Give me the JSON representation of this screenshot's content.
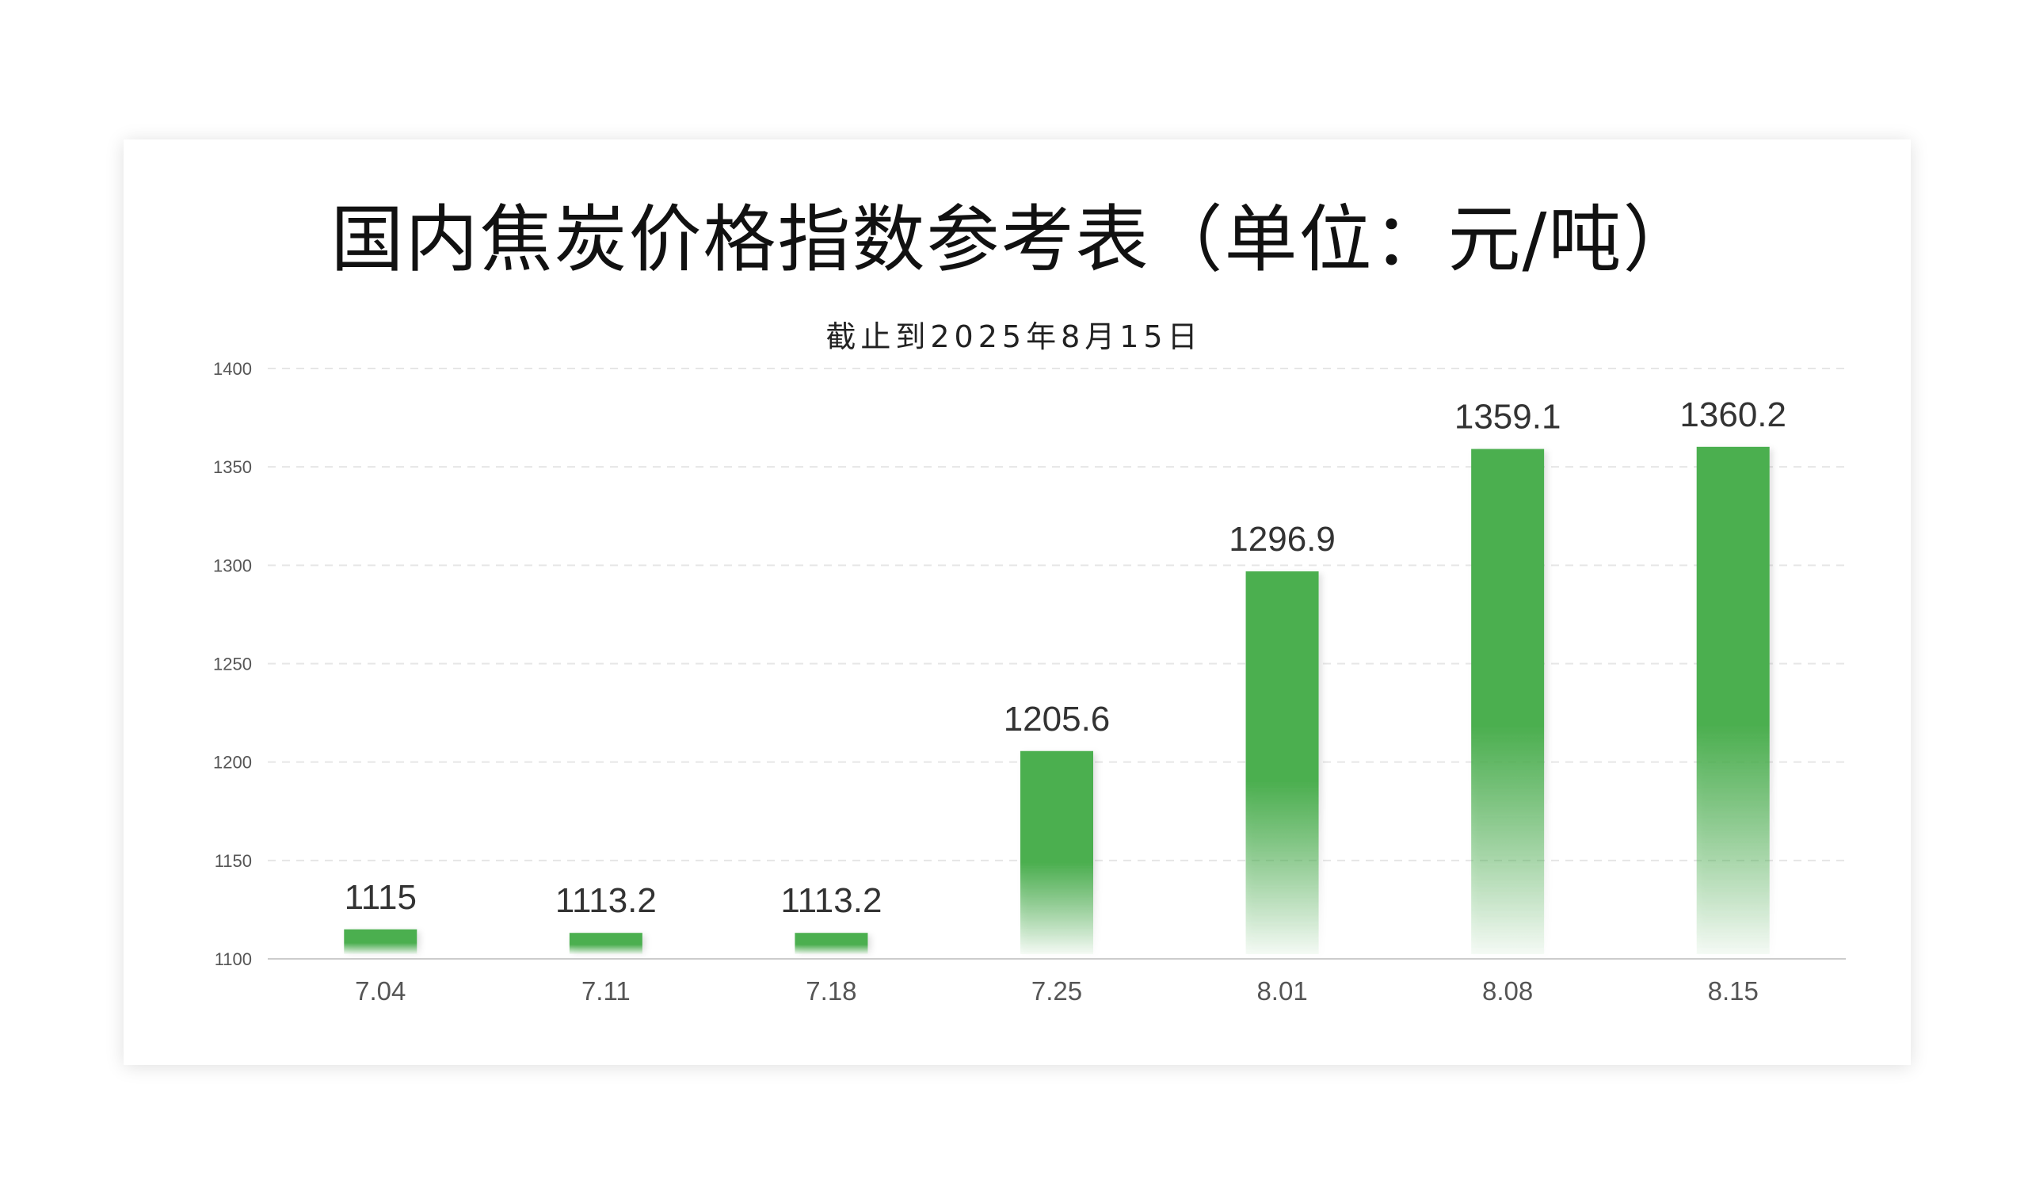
{
  "colors": {
    "bar": "#4caf50",
    "grid": "#e6e6e6",
    "axis": "#cccccc"
  },
  "chart_data": {
    "type": "bar",
    "title": "国内焦炭价格指数参考表（单位：元/吨）",
    "subtitle": "截止到2025年8月15日",
    "xlabel": "",
    "ylabel": "",
    "categories": [
      "7.04",
      "7.11",
      "7.18",
      "7.25",
      "8.01",
      "8.08",
      "8.15"
    ],
    "values": [
      1115,
      1113.2,
      1113.2,
      1205.6,
      1296.9,
      1359.1,
      1360.2
    ],
    "value_labels": [
      "1115",
      "1113.2",
      "1113.2",
      "1205.6",
      "1296.9",
      "1359.1",
      "1360.2"
    ],
    "ylim": [
      1100,
      1400
    ],
    "yticks": [
      1100,
      1150,
      1200,
      1250,
      1300,
      1350,
      1400
    ],
    "grid": true,
    "legend": "none"
  }
}
